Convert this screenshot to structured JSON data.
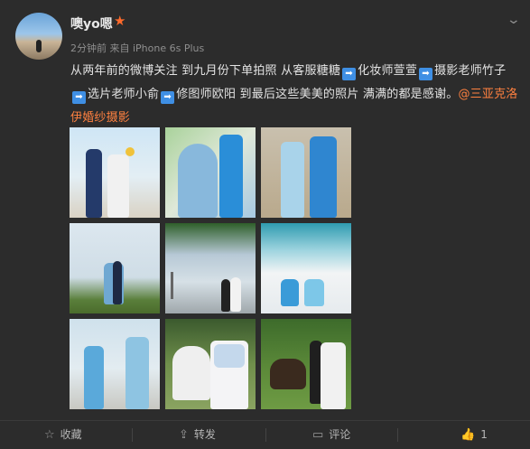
{
  "post": {
    "username": "噢yo嗯",
    "vip_icon": "star-icon",
    "meta": "2分钟前 来自 iPhone 6s Plus",
    "text": {
      "part1": "从两年前的微博关注 到九月份下单拍照 从客服糖糖",
      "part2": "化妆师萱萱",
      "part3": "摄影老师竹子",
      "part4": "选片老师小俞",
      "part5": "修图师欧阳 到最后这些美美的照片 满满的都是感谢。",
      "mention": "@三亚克洛伊婚纱摄影"
    },
    "arrow_icon": "right-arrow-icon"
  },
  "footer": {
    "collect": "收藏",
    "repost": "转发",
    "comment": "评论",
    "like_count": "1"
  },
  "colors": {
    "background": "#2c2c2c",
    "accent": "#ff8140",
    "arrow_badge": "#3f8fe4"
  }
}
